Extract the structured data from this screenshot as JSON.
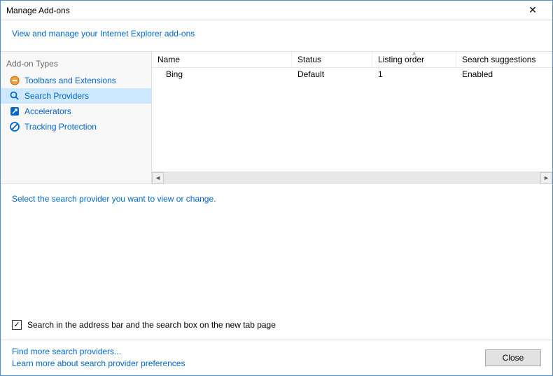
{
  "window": {
    "title": "Manage Add-ons"
  },
  "subheader": "View and manage your Internet Explorer add-ons",
  "sidebar": {
    "title": "Add-on Types",
    "items": [
      {
        "label": "Toolbars and Extensions"
      },
      {
        "label": "Search Providers"
      },
      {
        "label": "Accelerators"
      },
      {
        "label": "Tracking Protection"
      }
    ]
  },
  "columns": {
    "name": "Name",
    "status": "Status",
    "order": "Listing order",
    "sugg": "Search suggestions"
  },
  "rows": [
    {
      "name": "Bing",
      "status": "Default",
      "order": "1",
      "sugg": "Enabled"
    }
  ],
  "instruction": "Select the search provider you want to view or change.",
  "checkbox": {
    "label": "Search in the address bar and the search box on the new tab page",
    "checked": true
  },
  "footer": {
    "link1": "Find more search providers...",
    "link2": "Learn more about search provider preferences",
    "close": "Close"
  }
}
